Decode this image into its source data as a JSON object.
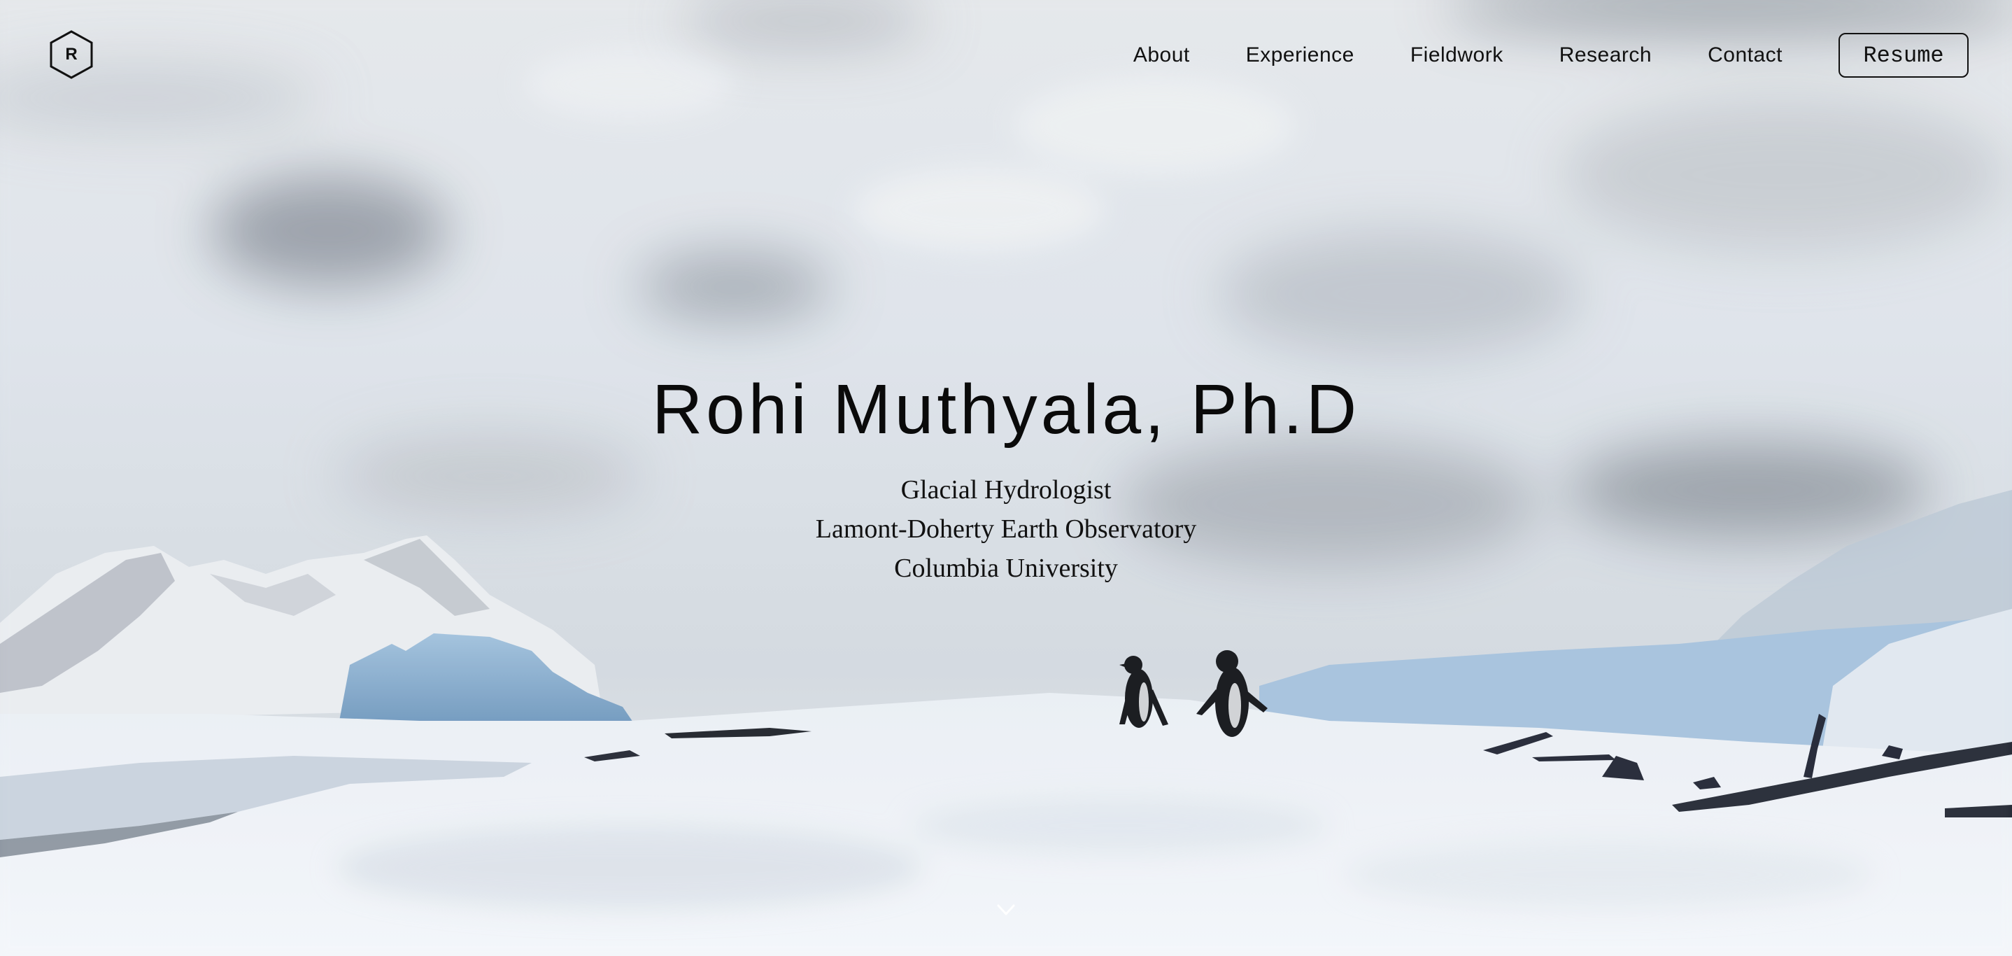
{
  "logo": {
    "letter": "R",
    "icon": "hexagon-logo-icon"
  },
  "nav": {
    "links": [
      {
        "label": "About"
      },
      {
        "label": "Experience"
      },
      {
        "label": "Fieldwork"
      },
      {
        "label": "Research"
      },
      {
        "label": "Contact"
      }
    ],
    "resume_label": "Resume"
  },
  "hero": {
    "name": "Rohi Muthyala, Ph.D",
    "subtitle_lines": [
      "Glacial Hydrologist",
      "Lamont-Doherty Earth Observatory",
      "Columbia University"
    ],
    "scroll_icon": "chevron-down-icon"
  },
  "colors": {
    "text": "#111111",
    "sky": "#dfe3e8",
    "ice_blue": "#8fb4d4",
    "snow": "#f1f4f8"
  }
}
